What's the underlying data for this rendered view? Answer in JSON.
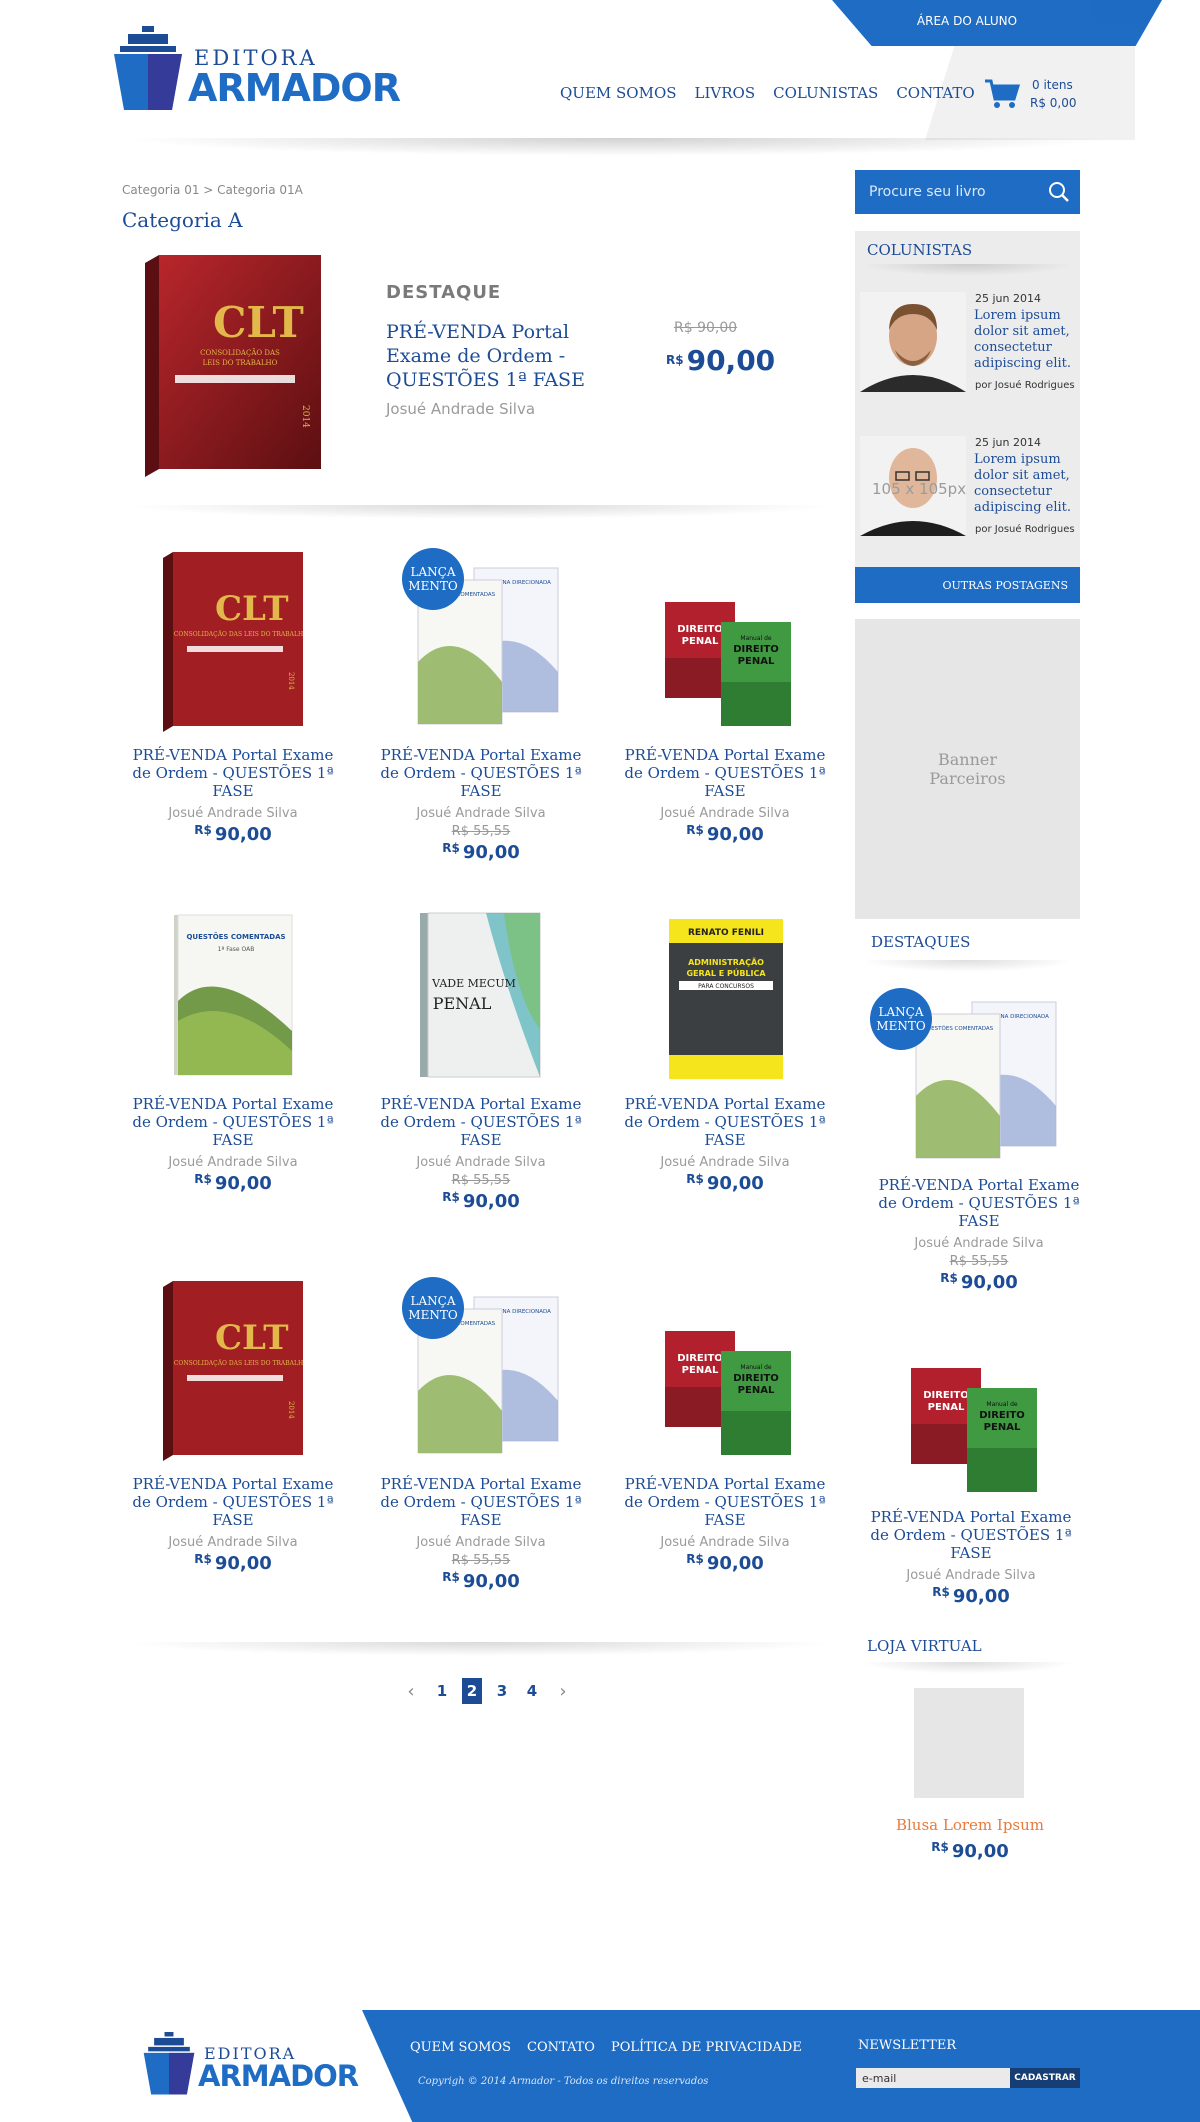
{
  "header": {
    "student_area": "ÁREA DO ALUNO",
    "logo_line1": "EDITORA",
    "logo_line2": "ARMADOR",
    "nav": [
      "QUEM SOMOS",
      "LIVROS",
      "COLUNISTAS",
      "CONTATO"
    ],
    "cart_count": "0 itens",
    "cart_total": "R$ 0,00"
  },
  "breadcrumb": "Categoria 01 > Categoria 01A",
  "page_title": "Categoria A",
  "featured": {
    "label": "DESTAQUE",
    "title": "PRÉ-VENDA Portal Exame de Ordem - QUESTÕES 1ª FASE",
    "author": "Josué Andrade Silva",
    "old_price": "R$ 90,00",
    "currency": "R$",
    "price": "90,00"
  },
  "badge_text": "LANÇA MENTO",
  "products": [
    {
      "title": "PRÉ-VENDA Portal Exame de Ordem - QUESTÕES 1ª FASE",
      "author": "Josué Andrade Silva",
      "old_price": "",
      "currency": "R$",
      "price": "90,00",
      "cover": "clt",
      "badge": false
    },
    {
      "title": "PRÉ-VENDA Portal Exame de Ordem - QUESTÕES 1ª FASE",
      "author": "Josué Andrade Silva",
      "old_price": "R$ 55,55",
      "currency": "R$",
      "price": "90,00",
      "cover": "twin",
      "badge": true
    },
    {
      "title": "PRÉ-VENDA Portal Exame de Ordem - QUESTÕES 1ª FASE",
      "author": "Josué Andrade Silva",
      "old_price": "",
      "currency": "R$",
      "price": "90,00",
      "cover": "penal",
      "badge": false
    },
    {
      "title": "PRÉ-VENDA Portal Exame de Ordem - QUESTÕES 1ª FASE",
      "author": "Josué Andrade Silva",
      "old_price": "",
      "currency": "R$",
      "price": "90,00",
      "cover": "green",
      "badge": false
    },
    {
      "title": "PRÉ-VENDA Portal Exame de Ordem - QUESTÕES 1ª FASE",
      "author": "Josué Andrade Silva",
      "old_price": "R$ 55,55",
      "currency": "R$",
      "price": "90,00",
      "cover": "vade",
      "badge": false
    },
    {
      "title": "PRÉ-VENDA Portal Exame de Ordem - QUESTÕES 1ª FASE",
      "author": "Josué Andrade Silva",
      "old_price": "",
      "currency": "R$",
      "price": "90,00",
      "cover": "admin",
      "badge": false
    },
    {
      "title": "PRÉ-VENDA Portal Exame de Ordem - QUESTÕES 1ª FASE",
      "author": "Josué Andrade Silva",
      "old_price": "",
      "currency": "R$",
      "price": "90,00",
      "cover": "clt",
      "badge": false
    },
    {
      "title": "PRÉ-VENDA Portal Exame de Ordem - QUESTÕES 1ª FASE",
      "author": "Josué Andrade Silva",
      "old_price": "R$ 55,55",
      "currency": "R$",
      "price": "90,00",
      "cover": "twin",
      "badge": true
    },
    {
      "title": "PRÉ-VENDA Portal Exame de Ordem - QUESTÕES 1ª FASE",
      "author": "Josué Andrade Silva",
      "old_price": "",
      "currency": "R$",
      "price": "90,00",
      "cover": "penal",
      "badge": false
    }
  ],
  "pagination": {
    "pages": [
      "1",
      "2",
      "3",
      "4"
    ],
    "active": "2"
  },
  "sidebar": {
    "search_placeholder": "Procure seu livro",
    "columnists_title": "COLUNISTAS",
    "columnists": [
      {
        "date": "25 jun 2014",
        "text": "Lorem ipsum dolor sit amet, consectetur adipiscing elit.",
        "by": "por Josué Rodrigues",
        "placeholder": ""
      },
      {
        "date": "25 jun 2014",
        "text": "Lorem ipsum dolor sit amet, consectetur adipiscing elit.",
        "by": "por Josué Rodrigues",
        "placeholder": "105 x 105px"
      }
    ],
    "more_posts": "OUTRAS POSTAGENS",
    "banner": "Banner Parceiros",
    "highlights_title": "DESTAQUES",
    "highlights": [
      {
        "title": "PRÉ-VENDA Portal Exame de Ordem - QUESTÕES 1ª FASE",
        "author": "Josué Andrade Silva",
        "old_price": "R$ 55,55",
        "currency": "R$",
        "price": "90,00"
      },
      {
        "title": "PRÉ-VENDA Portal Exame de Ordem - QUESTÕES 1ª FASE",
        "author": "Josué Andrade Silva",
        "old_price": "",
        "currency": "R$",
        "price": "90,00"
      }
    ],
    "shop_title": "LOJA VIRTUAL",
    "shop_item": "Blusa Lorem Ipsum",
    "shop_currency": "R$",
    "shop_price": "90,00"
  },
  "covers": {
    "clt_title": "CLT",
    "clt_sub": "CONSOLIDAÇÃO DAS LEIS DO TRABALHO",
    "clt_year": "2014",
    "penal_title": "Manual de DIREITO PENAL",
    "vade_title": "VADE MECUM PENAL",
    "admin_author": "RENATO FENILI",
    "admin_title": "ADMINISTRAÇÃO GERAL E PÚBLICA",
    "admin_sub": "PARA CONCURSOS",
    "green_title": "QUESTÕES COMENTADAS",
    "green_sub": "1ª Fase OAB",
    "twin_a": "QUESTÕES COMENTADAS",
    "twin_b": "DOUTRINA DIRECIONADA"
  },
  "footer": {
    "logo_line1": "EDITORA",
    "logo_line2": "ARMADOR",
    "nav": [
      "QUEM SOMOS",
      "CONTATO",
      "POLÍTICA DE PRIVACIDADE"
    ],
    "copyright": "Copyrigh © 2014 Armador - Todos os direitos reservados",
    "newsletter_label": "NEWSLETTER",
    "email_placeholder": "e-mail",
    "subscribe": "CADASTRAR"
  },
  "colors": {
    "brand_blue": "#1e6cc4",
    "dark_blue": "#1d4c96",
    "accent_orange": "#e87a3b"
  }
}
